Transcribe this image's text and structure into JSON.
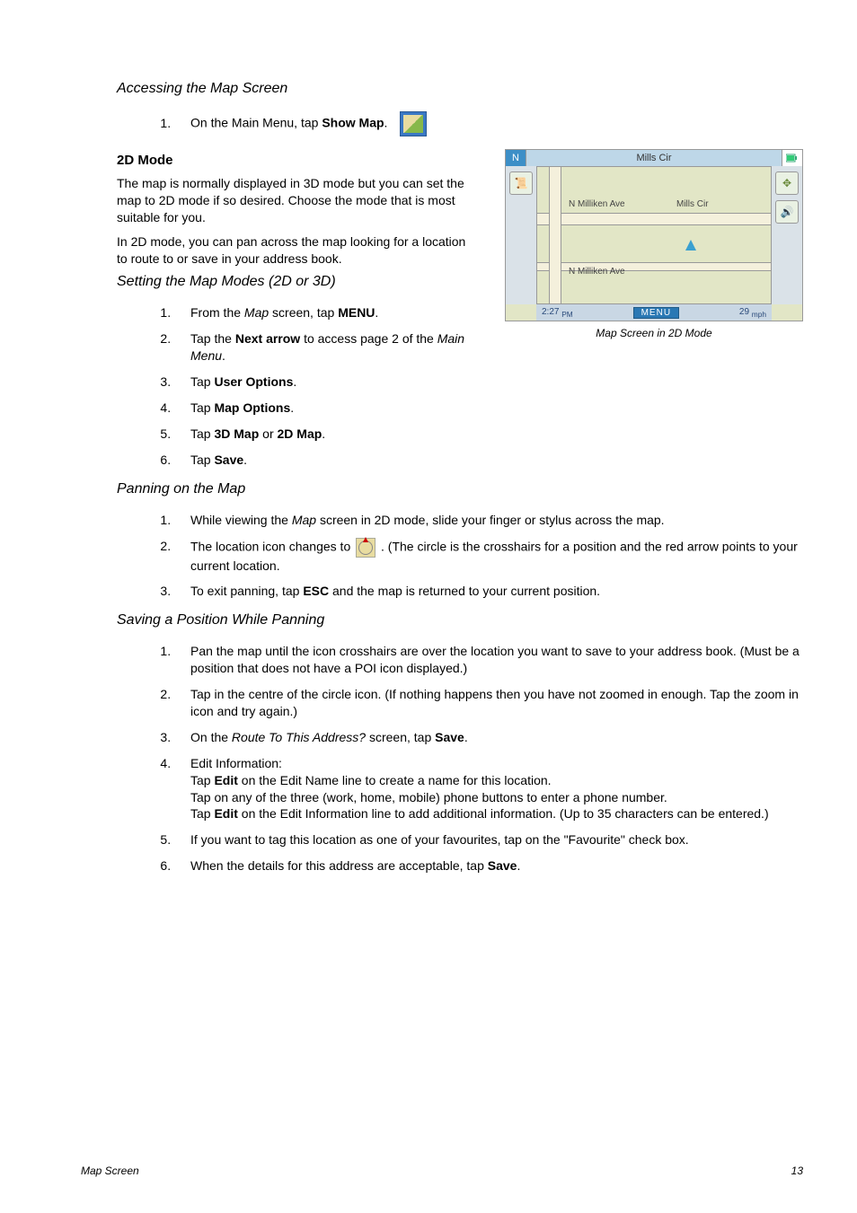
{
  "sections": {
    "accessing": {
      "title": "Accessing the Map Screen",
      "steps": [
        {
          "pre": "On the Main Menu, tap ",
          "bold": "Show Map",
          "post": "."
        }
      ]
    },
    "mode2d": {
      "title": "2D Mode",
      "p1": "The map is normally displayed in 3D mode but you can set the map to 2D mode if so desired.  Choose the mode that is most suitable for you.",
      "p2": "In 2D mode, you can pan across the map looking for a location to route to or save in your address book."
    },
    "setting": {
      "title": "Setting the Map Modes (2D or 3D)",
      "steps": {
        "s1_pre": "From the ",
        "s1_ital": "Map",
        "s1_mid": " screen, tap ",
        "s1_bold": "MENU",
        "s1_post": ".",
        "s2_pre": "Tap the ",
        "s2_bold": "Next arrow",
        "s2_mid": " to access page 2 of the ",
        "s2_ital": "Main Menu",
        "s2_post": ".",
        "s3_pre": "Tap ",
        "s3_bold": "User Options",
        "s3_post": ".",
        "s4_pre": "Tap ",
        "s4_bold": "Map Options",
        "s4_post": ".",
        "s5_pre": "Tap ",
        "s5_bold1": "3D Map",
        "s5_mid": " or ",
        "s5_bold2": "2D Map",
        "s5_post": ".",
        "s6_pre": "Tap ",
        "s6_bold": "Save",
        "s6_post": "."
      }
    },
    "panning": {
      "title": "Panning on the Map",
      "steps": {
        "s1_pre": "While viewing the ",
        "s1_ital": "Map",
        "s1_post": " screen in 2D mode, slide your finger or stylus across the map.",
        "s2_pre": " The location icon changes to  ",
        "s2_post": " .  (The circle is the crosshairs for a position and the red arrow points to your current location.",
        "s3_pre": "To exit panning, tap ",
        "s3_bold": "ESC",
        "s3_post": " and the map is returned to your current position."
      }
    },
    "saving": {
      "title": "Saving a Position While Panning",
      "steps": {
        "s1": "Pan the map until the icon crosshairs are over the location you want to save to your address book.  (Must be a position that does not have a POI icon displayed.)",
        "s2": "Tap in the centre of the circle icon. (If nothing happens then you have not zoomed in enough.  Tap the zoom in icon and try again.)",
        "s3_pre": "On the ",
        "s3_ital": "Route To This Address?",
        "s3_mid": " screen, tap ",
        "s3_bold": "Save",
        "s3_post": ".",
        "s4_line1": "Edit Information:",
        "s4_line2_pre": "Tap ",
        "s4_line2_bold": "Edit",
        "s4_line2_post": " on the Edit Name line to create a name for this location.",
        "s4_line3": "Tap on any of the three (work, home, mobile) phone buttons to enter a phone number.",
        "s4_line4_pre": "Tap ",
        "s4_line4_bold": "Edit",
        "s4_line4_post": " on the Edit Information line to add additional information.  (Up to 35 characters can be entered.)",
        "s5": "If you want to tag this location as one of your favourites, tap on the \"Favourite\" check box.",
        "s6_pre": "When the details for this address are acceptable, tap ",
        "s6_bold": "Save",
        "s6_post": "."
      }
    }
  },
  "figure": {
    "caption": "Map Screen in 2D Mode",
    "header_street": "Mills Cir",
    "n_label": "N",
    "street1": "N Milliken Ave",
    "street2": "Mills Cir",
    "street3": "N Milliken Ave",
    "time": "2:27",
    "time_unit": "PM",
    "menu": "MENU",
    "speed": "29",
    "speed_unit": "mph"
  },
  "footer": {
    "left": "Map Screen",
    "right": "13"
  }
}
